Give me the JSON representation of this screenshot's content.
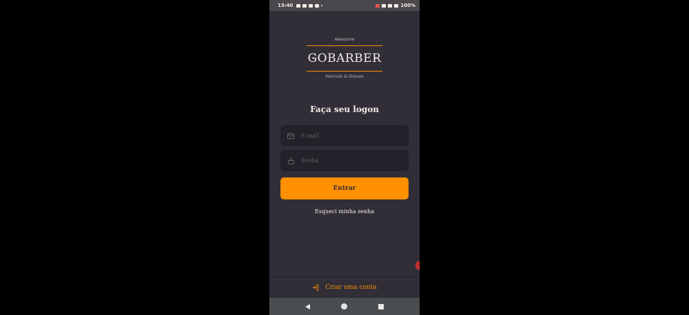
{
  "statusbar": {
    "time": "13:40",
    "battery": "100%"
  },
  "logo": {
    "top": "Awesome",
    "brand": "GOBARBER",
    "bottom": "Haircuts & Shaves"
  },
  "title": "Faça seu logon",
  "email": {
    "placeholder": "E-mail",
    "icon": "mail-icon"
  },
  "password": {
    "placeholder": "Senha",
    "icon": "lock-icon"
  },
  "submit_label": "Entrar",
  "forgot_label": "Esqueci minha senha",
  "footer": {
    "label": "Criar uma conta",
    "icon": "log-in-icon"
  },
  "colors": {
    "accent": "#ff9000",
    "background": "#312e38",
    "input": "#232129",
    "text": "#f4ede8",
    "placeholder": "#666360"
  }
}
